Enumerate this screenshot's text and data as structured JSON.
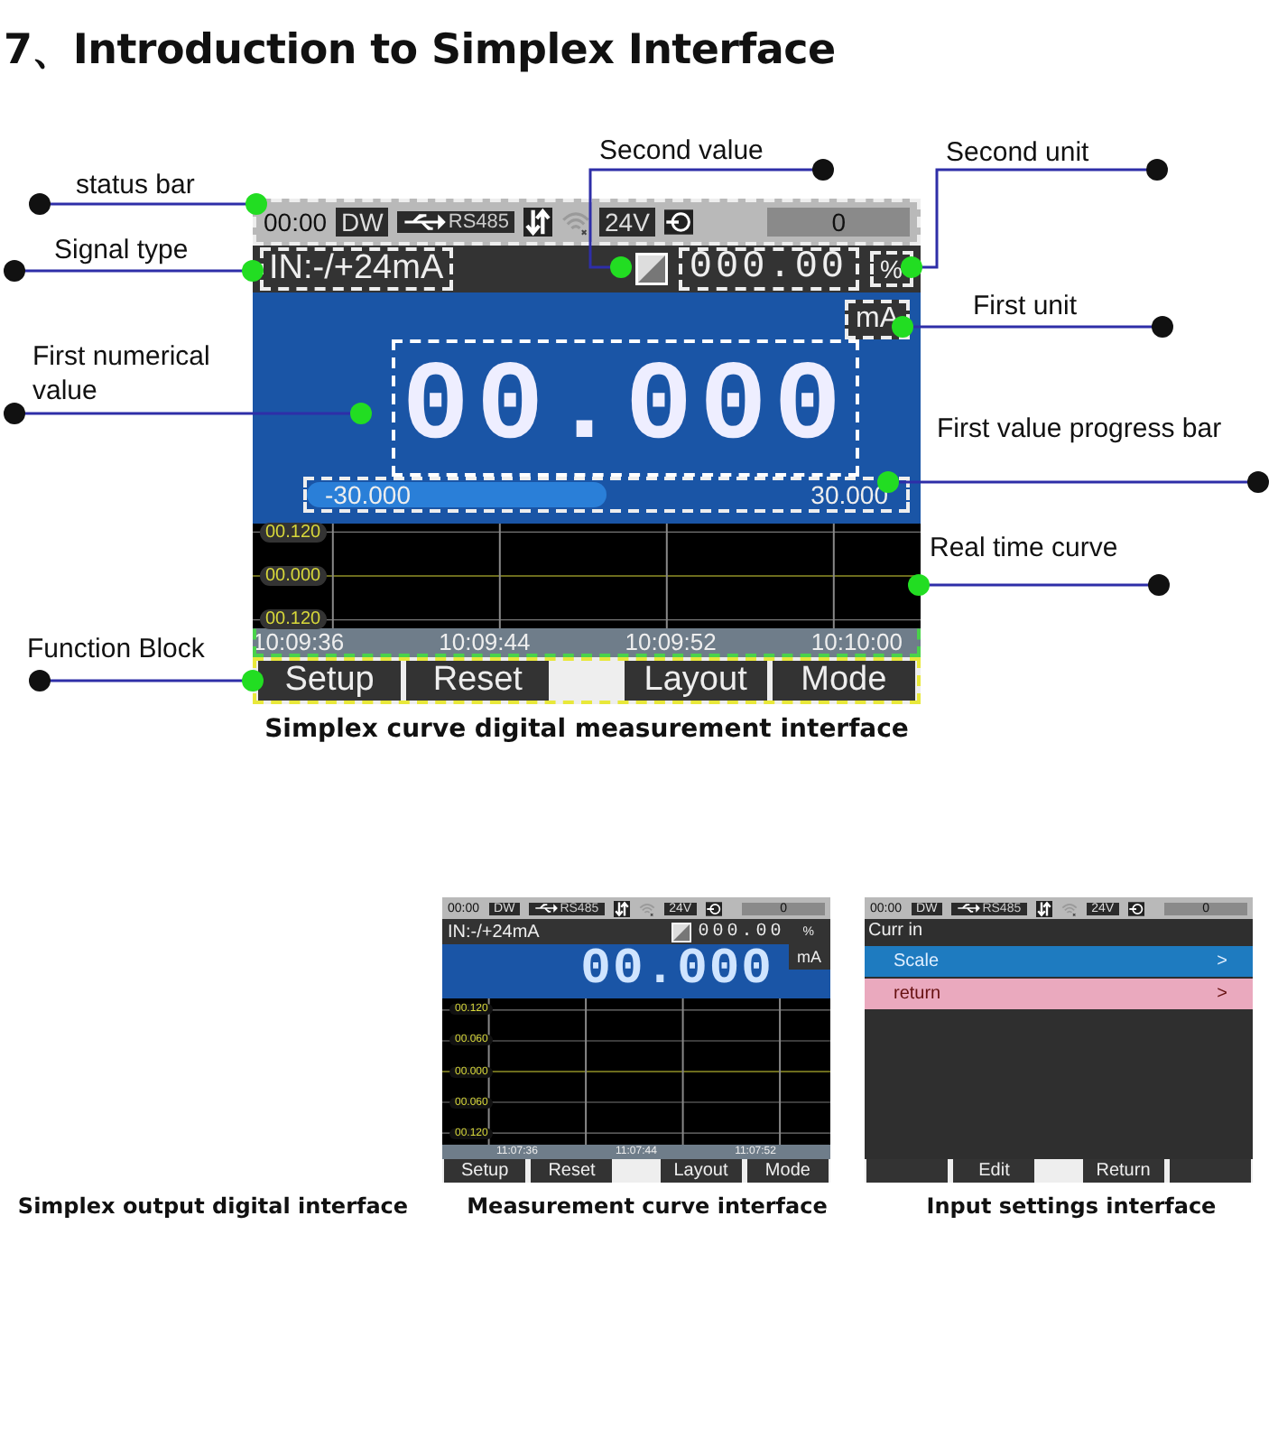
{
  "heading": "7、Introduction to Simplex Interface",
  "callouts": [
    {
      "label": "status bar"
    },
    {
      "label": "Signal type"
    },
    {
      "label": "First numerical value"
    },
    {
      "label": "Function Block"
    },
    {
      "label": "Second value"
    },
    {
      "label": "Second unit"
    },
    {
      "label": "First unit"
    },
    {
      "label": "First value progress bar"
    },
    {
      "label": "Real time curve"
    }
  ],
  "main_screen": {
    "status_bar": {
      "time": "00:00",
      "mode": "DW",
      "port": "RS485",
      "voltage": "24V",
      "count": "0"
    },
    "signal_type": "IN:-/+24mA",
    "second_value": "000.00",
    "second_unit": "%",
    "first_unit": "mA",
    "first_value": "00.000",
    "progress": {
      "min_label": "-30.000",
      "max_label": "30.000",
      "level": 0.5
    },
    "chart": {
      "y_ticks": [
        "00.120",
        "00.000",
        "00.120"
      ],
      "x_ticks": [
        "10:09:36",
        "10:09:44",
        "10:09:52",
        "10:10:00"
      ]
    },
    "buttons": [
      {
        "kind": "button",
        "label": "Setup"
      },
      {
        "kind": "button",
        "label": "Reset"
      },
      {
        "kind": "gap"
      },
      {
        "kind": "button",
        "label": "Layout"
      },
      {
        "kind": "button",
        "label": "Mode"
      }
    ]
  },
  "caption": "Simplex curve digital measurement interface",
  "thumbnails": [
    {
      "kind": "none",
      "caption": "Simplex output digital interface"
    },
    {
      "kind": "curve",
      "caption": "Measurement curve interface",
      "screen": {
        "status_bar": {
          "time": "00:00",
          "mode": "DW",
          "port": "RS485",
          "voltage": "24V",
          "count": "0"
        },
        "signal_type": "IN:-/+24mA",
        "second_value": "000.00",
        "second_unit": "%",
        "first_unit": "mA",
        "first_value": "00.000",
        "chart": {
          "y_ticks": [
            "00.120",
            "00.060",
            "00.000",
            "00.060",
            "00.120"
          ],
          "x_ticks": [
            "11:07:36",
            "11:07:44",
            "11:07:52"
          ]
        },
        "buttons": [
          {
            "kind": "button",
            "label": "Setup"
          },
          {
            "kind": "button",
            "label": "Reset"
          },
          {
            "kind": "gap"
          },
          {
            "kind": "button",
            "label": "Layout"
          },
          {
            "kind": "button",
            "label": "Mode"
          }
        ]
      }
    },
    {
      "kind": "menu",
      "caption": "Input settings interface",
      "screen": {
        "status_bar": {
          "time": "00:00",
          "mode": "DW",
          "port": "RS485",
          "voltage": "24V",
          "count": "0"
        },
        "title": "Curr in",
        "items": [
          {
            "label": "Scale",
            "arrow": ">",
            "color": "#1e7bc0"
          },
          {
            "label": "return",
            "arrow": ">",
            "color": "#eaa9be"
          }
        ],
        "buttons": [
          {
            "kind": "blank"
          },
          {
            "kind": "button",
            "label": "Edit"
          },
          {
            "kind": "gap"
          },
          {
            "kind": "button",
            "label": "Return"
          },
          {
            "kind": "blank"
          }
        ]
      }
    }
  ]
}
